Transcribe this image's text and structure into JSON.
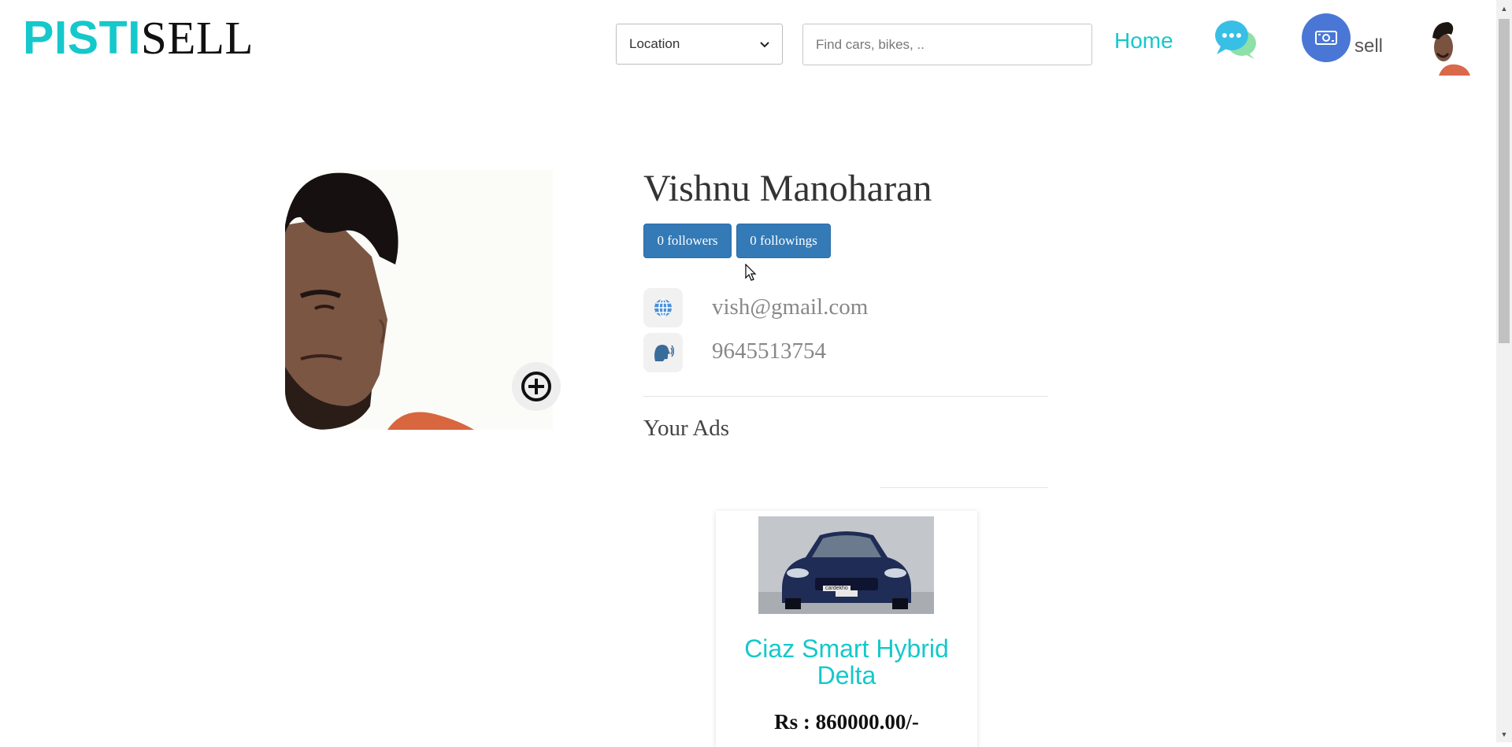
{
  "header": {
    "logo_part1": "PISTI",
    "logo_part2": "SELL",
    "location_select": {
      "selected": "Location",
      "options": [
        "Location"
      ]
    },
    "search": {
      "placeholder": "Find cars, bikes, .."
    },
    "home_label": "Home",
    "sell_label": "sell"
  },
  "profile": {
    "name": "Vishnu Manoharan",
    "followers_label": "0 followers",
    "followings_label": "0 followings",
    "email": "vish@gmail.com",
    "phone": "9645513754"
  },
  "ads": {
    "section_title": "Your Ads",
    "items": [
      {
        "title": "Ciaz Smart Hybrid Delta",
        "price": "Rs : 860000.00/-",
        "image_caption": "cardekho"
      }
    ]
  },
  "colors": {
    "brand_teal": "#15c8cb",
    "button_blue": "#337ab7",
    "sell_icon_bg": "#4a77d6"
  },
  "icons": [
    "chat-bubbles-icon",
    "money-icon",
    "globe-icon",
    "speaking-head-icon",
    "add-circle-icon",
    "chevron-down-icon"
  ]
}
